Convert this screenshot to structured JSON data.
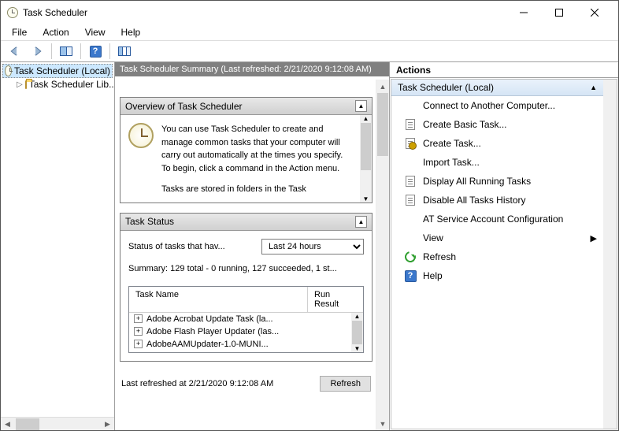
{
  "window": {
    "title": "Task Scheduler"
  },
  "menu": {
    "file": "File",
    "action": "Action",
    "view": "View",
    "help": "Help"
  },
  "tree": {
    "root": "Task Scheduler (Local)",
    "child": "Task Scheduler Lib..."
  },
  "center": {
    "header": "Task Scheduler Summary (Last refreshed: 2/21/2020 9:12:08 AM)",
    "overview_title": "Overview of Task Scheduler",
    "overview_para1": "You can use Task Scheduler to create and manage common tasks that your computer will carry out automatically at the times you specify. To begin, click a command in the Action menu.",
    "overview_para2": "Tasks are stored in folders in the Task",
    "task_status_title": "Task Status",
    "status_label": "Status of tasks that hav...",
    "period_selected": "Last 24 hours",
    "summary": "Summary: 129 total - 0 running, 127 succeeded, 1 st...",
    "col_task_name": "Task Name",
    "col_run_result": "Run Result",
    "tasks": [
      "Adobe Acrobat Update Task (la...",
      "Adobe Flash Player Updater (las...",
      "AdobeAAMUpdater-1.0-MUNI..."
    ],
    "last_refreshed": "Last refreshed at 2/21/2020 9:12:08 AM",
    "refresh_btn": "Refresh"
  },
  "actions": {
    "header": "Actions",
    "section": "Task Scheduler (Local)",
    "items": {
      "connect": "Connect to Another Computer...",
      "create_basic": "Create Basic Task...",
      "create_task": "Create Task...",
      "import": "Import Task...",
      "display_running": "Display All Running Tasks",
      "disable_history": "Disable All Tasks History",
      "at_service": "AT Service Account Configuration",
      "view": "View",
      "refresh": "Refresh",
      "help": "Help"
    }
  }
}
